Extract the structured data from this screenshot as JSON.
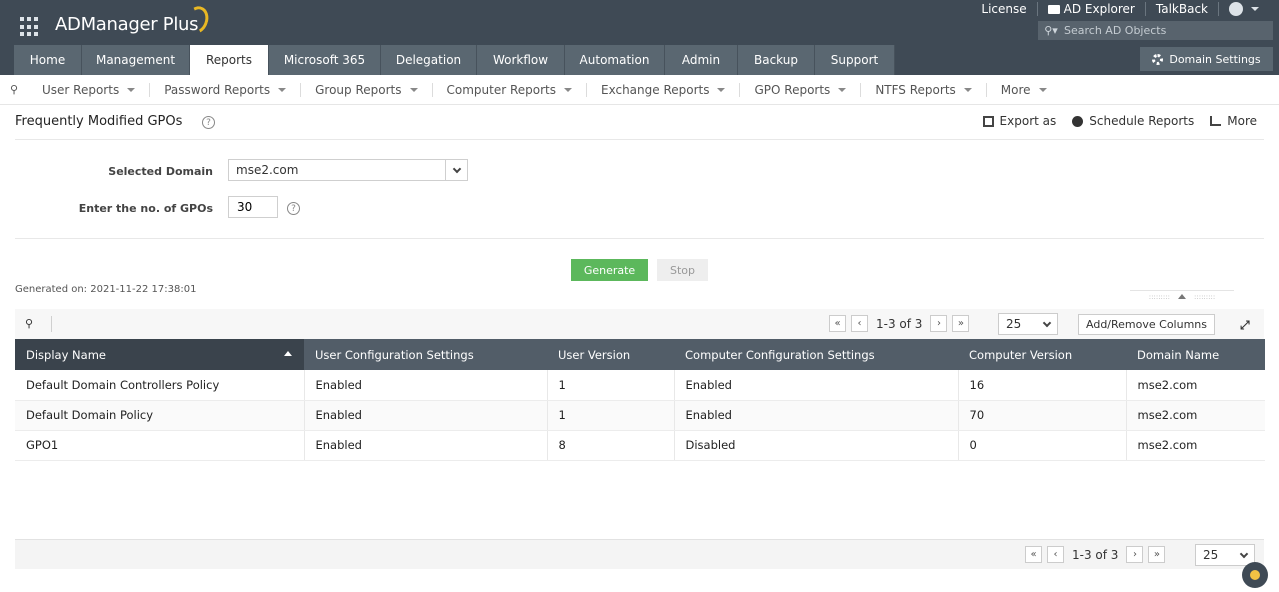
{
  "app": {
    "name": "ADManager Plus"
  },
  "toplinks": {
    "license": "License",
    "ad_explorer": "AD Explorer",
    "talkback": "TalkBack"
  },
  "search": {
    "placeholder": "Search AD Objects"
  },
  "tabs": [
    {
      "label": "Home",
      "active": false
    },
    {
      "label": "Management",
      "active": false
    },
    {
      "label": "Reports",
      "active": true
    },
    {
      "label": "Microsoft 365",
      "active": false
    },
    {
      "label": "Delegation",
      "active": false
    },
    {
      "label": "Workflow",
      "active": false
    },
    {
      "label": "Automation",
      "active": false
    },
    {
      "label": "Admin",
      "active": false
    },
    {
      "label": "Backup",
      "active": false
    },
    {
      "label": "Support",
      "active": false
    }
  ],
  "domain_settings": "Domain Settings",
  "subnav": [
    "User Reports",
    "Password Reports",
    "Group Reports",
    "Computer Reports",
    "Exchange Reports",
    "GPO Reports",
    "NTFS Reports",
    "More"
  ],
  "page": {
    "title": "Frequently Modified GPOs",
    "actions": {
      "export": "Export as",
      "schedule": "Schedule Reports",
      "more": "More"
    }
  },
  "form": {
    "domain_label": "Selected Domain",
    "domain_value": "mse2.com",
    "gpo_count_label": "Enter the no. of GPOs",
    "gpo_count_value": "30",
    "generate": "Generate",
    "stop": "Stop",
    "generated_on": "Generated on: 2021-11-22 17:38:01"
  },
  "grid": {
    "page_info": "1-3 of 3",
    "page_size": "25",
    "add_remove": "Add/Remove Columns",
    "columns": [
      "Display Name",
      "User Configuration Settings",
      "User Version",
      "Computer Configuration Settings",
      "Computer Version",
      "Domain Name"
    ],
    "rows": [
      [
        "Default Domain Controllers Policy",
        "Enabled",
        "1",
        "Enabled",
        "16",
        "mse2.com"
      ],
      [
        "Default Domain Policy",
        "Enabled",
        "1",
        "Enabled",
        "70",
        "mse2.com"
      ],
      [
        "GPO1",
        "Enabled",
        "8",
        "Disabled",
        "0",
        "mse2.com"
      ]
    ]
  },
  "colors": {
    "header_bg": "#3f4a55",
    "tab_bg": "#5a6771",
    "generate_green": "#5cb85c",
    "table_header": "#525d68"
  }
}
